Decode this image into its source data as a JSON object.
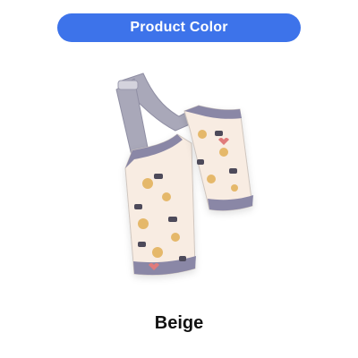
{
  "header": {
    "title": "Product Color"
  },
  "product": {
    "image_name": "fabric-carrier-image",
    "color_name": "Beige",
    "colors": {
      "fabric": "#f8ece2",
      "trim": "#8a87a6",
      "strap": "#a9a8b9",
      "buckle": "#d4d3dd"
    }
  },
  "theme": {
    "accent": "#3d73ea",
    "background": "#ffffff",
    "text": "#111111"
  }
}
